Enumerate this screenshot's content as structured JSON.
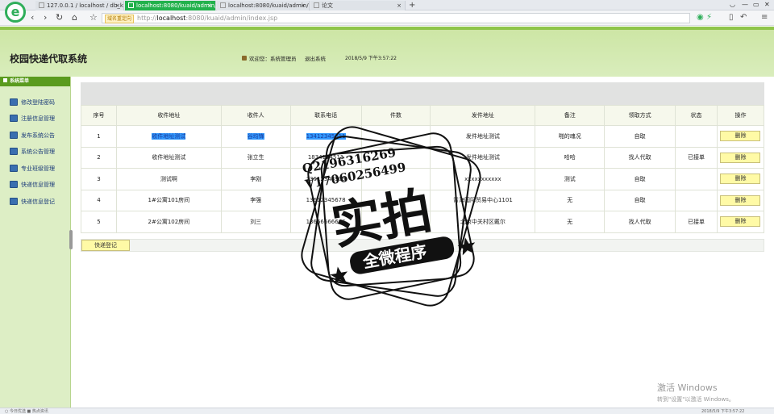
{
  "browser": {
    "tabs": [
      {
        "label": "127.0.0.1 / localhost / db_kuai",
        "active": false
      },
      {
        "label": "localhost:8080/kuaid/admin/i",
        "active": true
      },
      {
        "label": "localhost:8080/kuaid/admin/",
        "active": false
      },
      {
        "label": "论文",
        "active": false
      }
    ],
    "address_badge": "域名重定向",
    "address_scheme": "http://",
    "address_host": "localhost",
    "address_path": ":8080/kuaid/admin/index.jsp",
    "nav": {
      "back": "‹",
      "forward": "›",
      "reload": "↻",
      "home": "⌂",
      "star": "☆"
    }
  },
  "header": {
    "title": "校园快递代取系统",
    "welcome": "欢迎您：系统管理员",
    "logout": "退出系统",
    "datetime": "2018/5/9 下午3:57:22"
  },
  "sidebar": {
    "title": "系统菜单",
    "items": [
      {
        "label": "修改登陆密码",
        "icon": "key-icon"
      },
      {
        "label": "注册信息管理",
        "icon": "users-icon"
      },
      {
        "label": "发布系统公告",
        "icon": "announce-icon"
      },
      {
        "label": "系统公告管理",
        "icon": "notice-icon"
      },
      {
        "label": "专业班级管理",
        "icon": "class-icon"
      },
      {
        "label": "快递信息管理",
        "icon": "package-icon"
      },
      {
        "label": "快递信息登记",
        "icon": "register-icon"
      }
    ]
  },
  "table": {
    "headers": [
      "序号",
      "收件地址",
      "收件人",
      "联系电话",
      "件数",
      "发件地址",
      "备注",
      "领取方式",
      "状态",
      "操作"
    ],
    "rows": [
      [
        "1",
        "收件地址测试",
        "谷均锋",
        "13412345611",
        "",
        "发件地址测试",
        "啪的魂况",
        "自取",
        "",
        "删除"
      ],
      [
        "2",
        "收件地址测试",
        "张立生",
        "1834124511",
        "",
        "发件地址测试",
        "哈哈",
        "找人代取",
        "已接单",
        "删除"
      ],
      [
        "3",
        "测试啊",
        "李刚",
        "13612348905",
        "",
        "xxxxxxxxxxx",
        "测试",
        "自取",
        "",
        "删除"
      ],
      [
        "4",
        "1#公寓101房间",
        "李强",
        "13612345678",
        "",
        "青海国际贸易中心1101",
        "无",
        "自取",
        "",
        "删除"
      ],
      [
        "5",
        "2#公寓102房间",
        "刘三",
        "13666666666",
        "",
        "北京中关村区戴尔",
        "无",
        "找人代取",
        "已接单",
        "删除"
      ]
    ]
  },
  "register_button": "快递登记",
  "watermark": {
    "qq": "Q2196316269",
    "wx": "V17060256499",
    "main": "实拍",
    "sub": "全微程序"
  },
  "os": {
    "activate_title": "激活 Windows",
    "activate_sub": "转到\"设置\"以激活 Windows。",
    "status_left": "○ 今日优选 ■ 热点资讯",
    "status_time": "2018/5/9 下午3:57:22"
  },
  "colors": {
    "header_bg": "#d3e9b2",
    "sidebar_bg": "#ddeec5",
    "accent": "#5a9b1e",
    "button_bg": "#fffaa6",
    "active_tab": "#22b14c"
  }
}
